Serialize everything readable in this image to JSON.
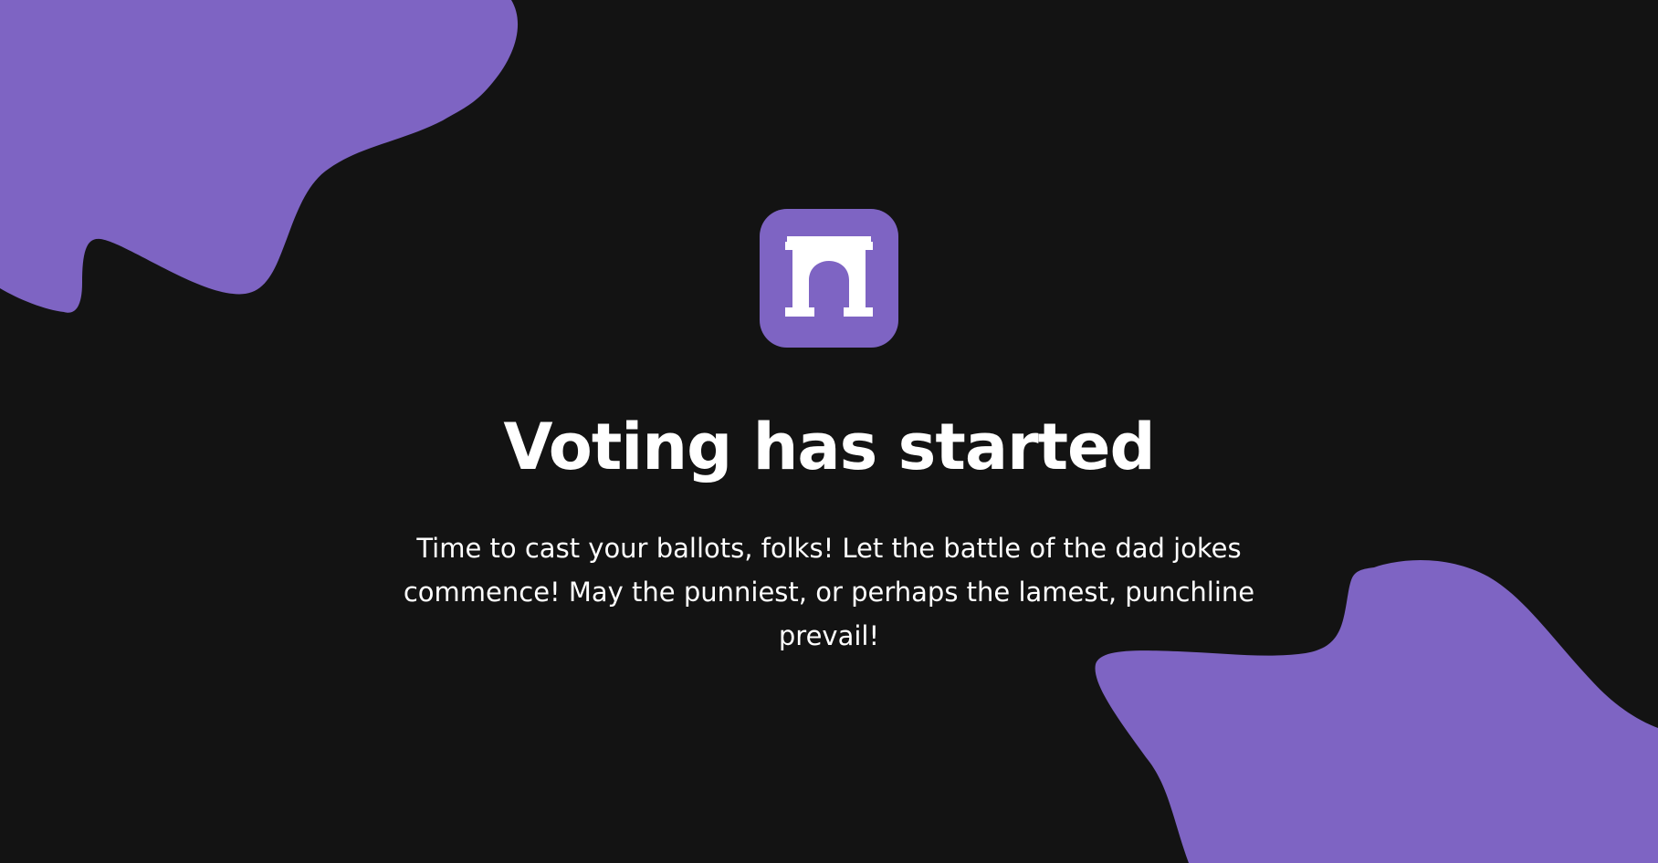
{
  "colors": {
    "background": "#131313",
    "accent": "#7e64c3",
    "text": "#ffffff"
  },
  "logo": {
    "icon": "arch-icon"
  },
  "heading": {
    "title": "Voting has started"
  },
  "message": {
    "text": "Time to cast your ballots, folks! Let the battle of the dad jokes commence! May the punniest, or perhaps the lamest, punchline prevail!"
  }
}
